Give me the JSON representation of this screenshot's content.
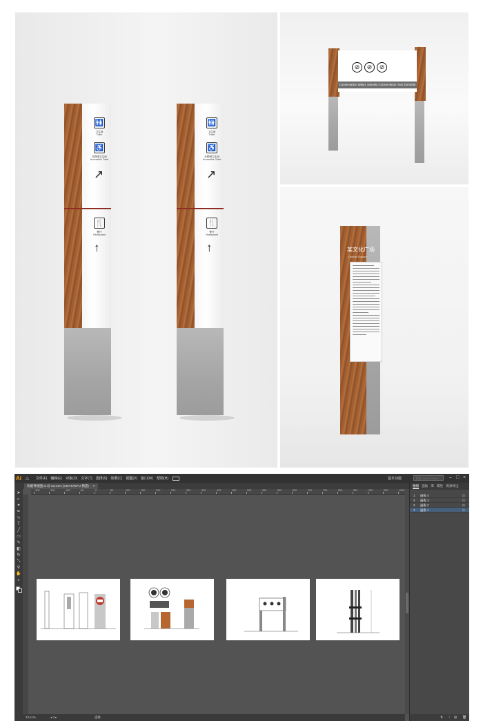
{
  "signage": {
    "toilet_label": "卫生间",
    "toilet_sub": "Toilet",
    "accessible_label": "无障碍卫生间",
    "accessible_sub": "Accessible Toilet",
    "restaurant_label": "餐厅",
    "restaurant_sub": "Restaurant",
    "gate_slogan": "Conservation Water, Namely Conservation Your Domicile",
    "culture_title": "某文化广场",
    "culture_subtitle": "Cultural Square"
  },
  "menu": {
    "items": [
      "文件(F)",
      "编辑(E)",
      "对象(O)",
      "文字(T)",
      "选择(S)",
      "效果(C)",
      "视图(V)",
      "窗口(W)",
      "帮助(H)"
    ],
    "workspace": "基本功能",
    "search_placeholder": "搜索 Adobe Stock"
  },
  "document": {
    "tab_title": "功能导视图.ai @ 33.41% (CMYK/GPU 预览)",
    "close_glyph": "✕"
  },
  "ruler": {
    "labels": [
      "-200",
      "-150",
      "-100",
      "-50",
      "0",
      "50",
      "100",
      "150",
      "200",
      "250",
      "300",
      "350",
      "400",
      "450",
      "500",
      "550",
      "600",
      "650",
      "700",
      "750",
      "800",
      "850",
      "900",
      "950",
      "1000"
    ]
  },
  "status": {
    "zoom": "33.41%",
    "page_current": "4",
    "tool": "选择"
  },
  "layers_panel": {
    "tabs": [
      "图层",
      "画板",
      "库",
      "属性",
      "资源导出"
    ],
    "active_tab": "图层",
    "layers": [
      {
        "num": "1",
        "name": "画板 4"
      },
      {
        "num": "2",
        "name": "画板 3"
      },
      {
        "num": "3",
        "name": "画板 2"
      },
      {
        "num": "4",
        "name": "画板 1"
      }
    ],
    "selected_index": 3
  },
  "colors": {
    "wood": "#a96536",
    "ui_dark": "#323232",
    "ui_canvas": "#535353",
    "accent_divider": "#8e2d22"
  }
}
